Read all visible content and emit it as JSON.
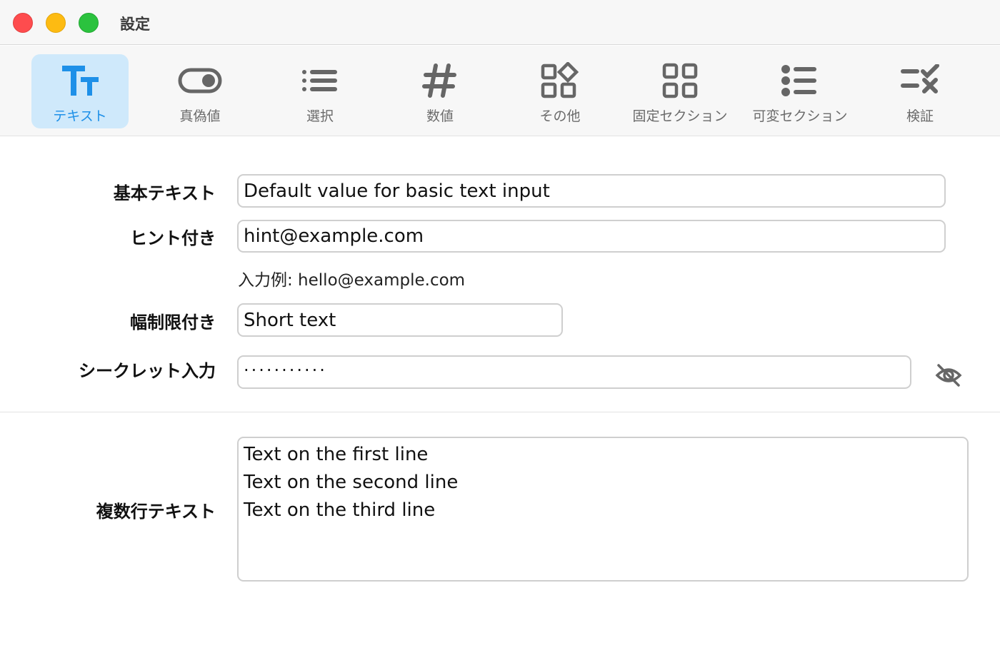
{
  "window": {
    "title": "設定"
  },
  "toolbar": {
    "tabs": [
      {
        "label": "テキスト",
        "icon": "text-format-icon",
        "active": true
      },
      {
        "label": "真偽値",
        "icon": "toggle-icon",
        "active": false
      },
      {
        "label": "選択",
        "icon": "list-icon",
        "active": false
      },
      {
        "label": "数値",
        "icon": "number-hash-icon",
        "active": false
      },
      {
        "label": "その他",
        "icon": "shapes-grid-icon",
        "active": false
      },
      {
        "label": "固定セクション",
        "icon": "grid-icon",
        "active": false
      },
      {
        "label": "可変セクション",
        "icon": "bullet-list-icon",
        "active": false
      },
      {
        "label": "検証",
        "icon": "checklist-validate-icon",
        "active": false
      }
    ],
    "accent_color": "#1e90e8",
    "active_bg": "#cfe9fb"
  },
  "form": {
    "basic": {
      "label": "基本テキスト",
      "value": "Default value for basic text input"
    },
    "hint": {
      "label": "ヒント付き",
      "value": "hint@example.com",
      "hint_text": "入力例: hello@example.com"
    },
    "width_limited": {
      "label": "幅制限付き",
      "value": "Short text"
    },
    "secret": {
      "label": "シークレット入力",
      "masked_value": "···········",
      "toggle_icon": "eye-slash-icon"
    },
    "multiline": {
      "label": "複数行テキスト",
      "lines": [
        "Text on the first line",
        "Text on the second line",
        "Text on the third line"
      ]
    }
  }
}
